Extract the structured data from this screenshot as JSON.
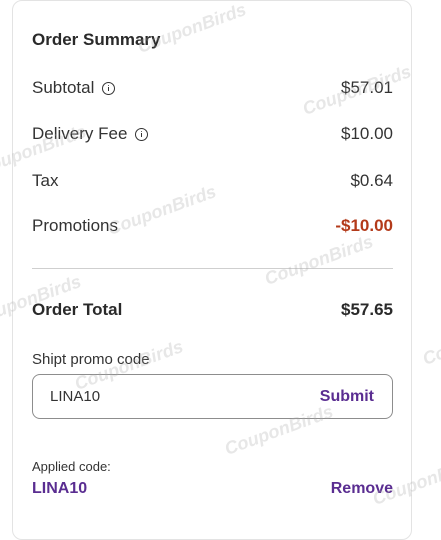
{
  "summary": {
    "title": "Order Summary",
    "subtotal_label": "Subtotal",
    "subtotal_value": "$57.01",
    "delivery_label": "Delivery Fee",
    "delivery_value": "$10.00",
    "tax_label": "Tax",
    "tax_value": "$0.64",
    "promotions_label": "Promotions",
    "promotions_value": "-$10.00",
    "total_label": "Order Total",
    "total_value": "$57.65"
  },
  "promo": {
    "field_label": "Shipt promo code",
    "input_value": "LINA10",
    "submit_label": "Submit",
    "applied_label": "Applied code:",
    "applied_code": "LINA10",
    "remove_label": "Remove"
  },
  "watermark": {
    "text": "CouponBirds"
  },
  "colors": {
    "accent": "#5a2d91",
    "promotion": "#b33a1a",
    "border": "#e3e3e3"
  }
}
